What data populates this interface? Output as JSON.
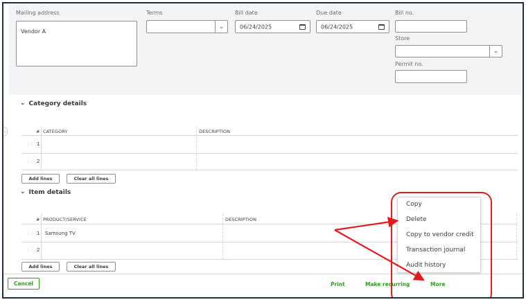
{
  "header": {
    "mailing_address": {
      "label": "Mailing address",
      "value": "Vendor A"
    },
    "terms": {
      "label": "Terms",
      "value": ""
    },
    "bill_date": {
      "label": "Bill date",
      "value": "06/24/2025"
    },
    "due_date": {
      "label": "Due date",
      "value": "06/24/2025"
    },
    "bill_no": {
      "label": "Bill no.",
      "value": ""
    },
    "store": {
      "label": "Store",
      "value": ""
    },
    "permit_no": {
      "label": "Permit no.",
      "value": ""
    }
  },
  "category_details": {
    "title": "Category details",
    "columns": [
      "#",
      "CATEGORY",
      "DESCRIPTION"
    ],
    "rows": [
      {
        "num": "1"
      },
      {
        "num": "2"
      }
    ],
    "add_lines": "Add lines",
    "clear_all_lines": "Clear all lines"
  },
  "item_details": {
    "title": "Item details",
    "columns": [
      "#",
      "PRODUCT/SERVICE",
      "DESCRIPTION"
    ],
    "rows": [
      {
        "num": "1",
        "product": "Samsung TV"
      },
      {
        "num": "2",
        "product": ""
      }
    ],
    "add_lines": "Add lines",
    "clear_all_lines": "Clear all lines"
  },
  "more_menu": {
    "items": [
      "Copy",
      "Delete",
      "Copy to vendor credit",
      "Transaction journal",
      "Audit history"
    ]
  },
  "footer": {
    "cancel": "Cancel",
    "print": "Print",
    "make_recurring": "Make recurring",
    "more": "More"
  },
  "annotation": {
    "color": "#e3191c",
    "highlight": "more-menu"
  },
  "colors": {
    "accent_green": "#2ca01c",
    "header_bg": "#f3f4f6"
  }
}
